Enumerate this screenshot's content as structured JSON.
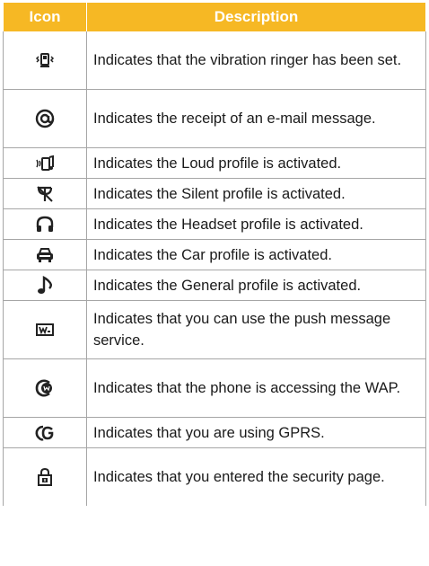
{
  "table": {
    "headers": {
      "icon": "Icon",
      "description": "Description"
    },
    "rows": [
      {
        "icon": "vibration-icon",
        "description": "Indicates that the vibration ringer has been set."
      },
      {
        "icon": "email-at-icon",
        "description": "Indicates the receipt of an e-mail message."
      },
      {
        "icon": "loud-profile-icon",
        "description": "Indicates the Loud profile is activated."
      },
      {
        "icon": "silent-profile-icon",
        "description": "Indicates the Silent profile is activated."
      },
      {
        "icon": "headset-profile-icon",
        "description": "Indicates the Headset profile is activated."
      },
      {
        "icon": "car-profile-icon",
        "description": "Indicates the Car profile is activated."
      },
      {
        "icon": "general-profile-icon",
        "description": "Indicates the General profile is activated."
      },
      {
        "icon": "push-message-icon",
        "description": "Indicates that you can use the push message service."
      },
      {
        "icon": "wap-access-icon",
        "description": "Indicates that the phone is accessing the WAP."
      },
      {
        "icon": "gprs-icon",
        "description": "Indicates that you are using GPRS."
      },
      {
        "icon": "security-page-icon",
        "description": "Indicates that you entered the security page."
      }
    ]
  }
}
